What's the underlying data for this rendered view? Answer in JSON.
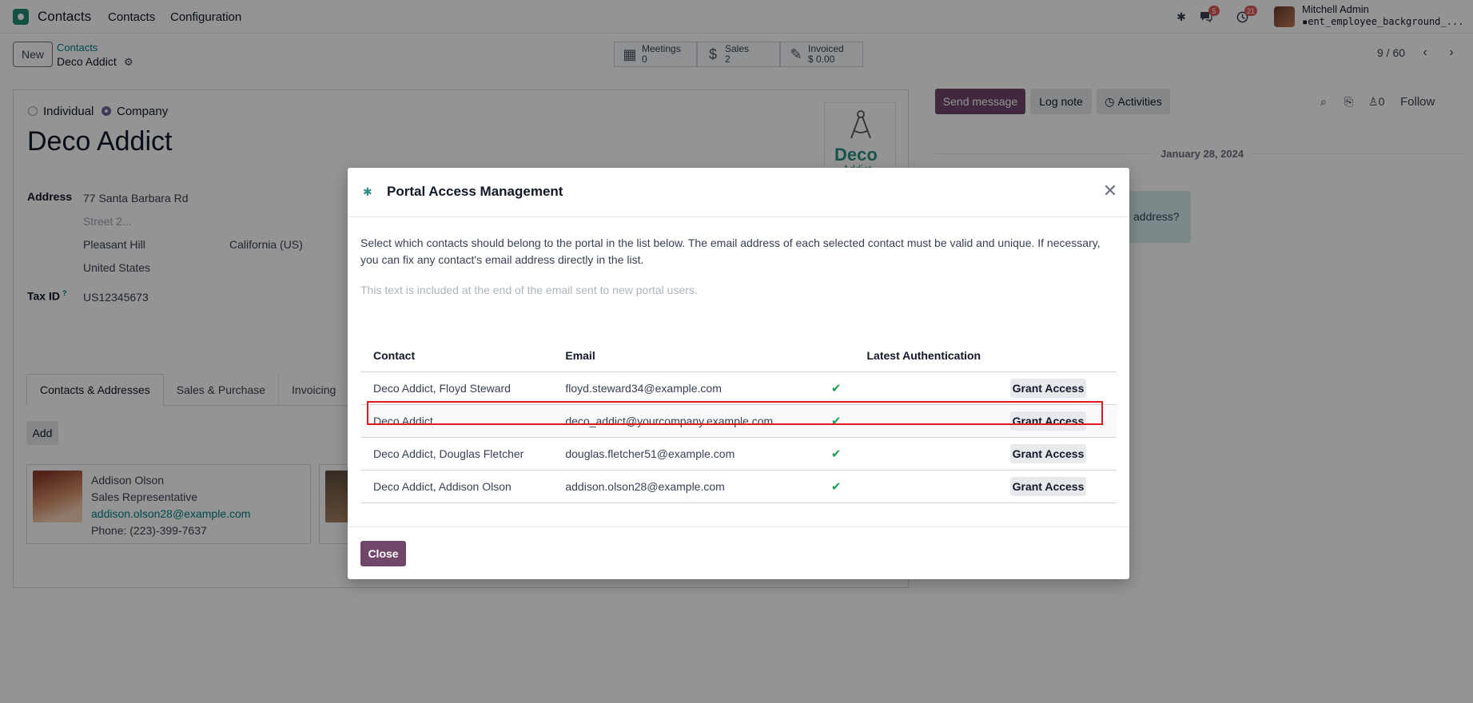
{
  "topnav": {
    "app_name": "Contacts",
    "menu": [
      "Contacts",
      "Configuration"
    ],
    "messages_badge": "5",
    "activities_badge": "21",
    "user_name": "Mitchell Admin",
    "user_db": "ent_employee_background_..."
  },
  "control": {
    "new_label": "New",
    "breadcrumb_parent": "Contacts",
    "breadcrumb_current": "Deco Addict",
    "stats": [
      {
        "label": "Meetings",
        "value": "0",
        "icon": "calendar-icon"
      },
      {
        "label": "Sales",
        "value": "2",
        "icon": "dollar-icon"
      },
      {
        "label": "Invoiced",
        "value": "$ 0.00",
        "icon": "invoice-icon"
      }
    ],
    "pager": "9 / 60"
  },
  "form": {
    "type_individual": "Individual",
    "type_company": "Company",
    "name": "Deco Addict",
    "address_label": "Address",
    "street": "77 Santa Barbara Rd",
    "street2_placeholder": "Street 2...",
    "city": "Pleasant Hill",
    "state": "California (US)",
    "country": "United States",
    "tax_label": "Tax ID",
    "tax_help": "?",
    "tax_value": "US12345673",
    "logo_text_1": "Deco",
    "logo_text_2": "Addict",
    "tabs": [
      "Contacts & Addresses",
      "Sales & Purchase",
      "Invoicing"
    ],
    "add_label": "Add",
    "contact_card": {
      "name": "Addison Olson",
      "role": "Sales Representative",
      "email": "addison.olson28@example.com",
      "phone": "Phone: (223)-399-7637"
    }
  },
  "chatter": {
    "send_message": "Send message",
    "log_note": "Log note",
    "activities": "Activities",
    "followers_count": "0",
    "follow": "Follow",
    "date": "January 28, 2024",
    "message_fragment": "address?"
  },
  "dialog": {
    "title": "Portal Access Management",
    "description": "Select which contacts should belong to the portal in the list below. The email address of each selected contact must be valid and unique. If necessary, you can fix any contact's email address directly in the list.",
    "welcome_placeholder": "This text is included at the end of the email sent to new portal users.",
    "columns": {
      "contact": "Contact",
      "email": "Email",
      "latest_auth": "Latest Authentication"
    },
    "rows": [
      {
        "contact": "Deco Addict, Floyd Steward",
        "email": "floyd.steward34@example.com",
        "button": "Grant Access"
      },
      {
        "contact": "Deco Addict",
        "email": "deco_addict@yourcompany.example.com",
        "button": "Grant Access"
      },
      {
        "contact": "Deco Addict, Douglas Fletcher",
        "email": "douglas.fletcher51@example.com",
        "button": "Grant Access"
      },
      {
        "contact": "Deco Addict, Addison Olson",
        "email": "addison.olson28@example.com",
        "button": "Grant Access"
      }
    ],
    "close_label": "Close"
  }
}
